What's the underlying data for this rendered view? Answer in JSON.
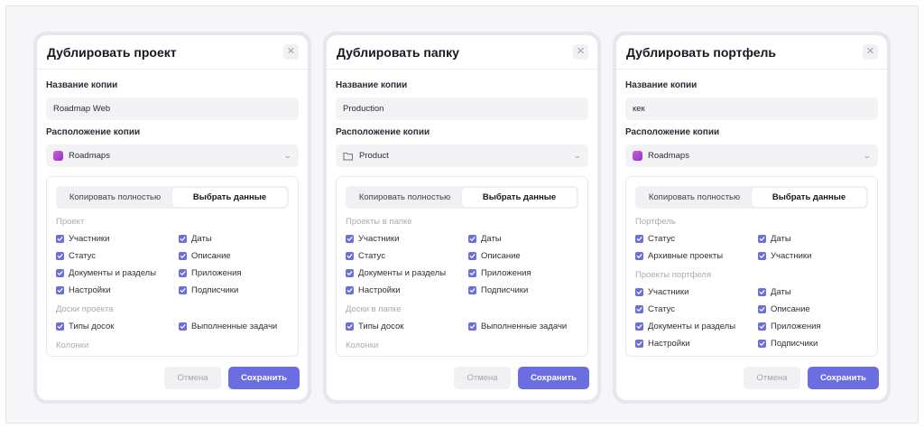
{
  "dialogs": [
    {
      "title": "Дублировать проект",
      "name_label": "Название копии",
      "name_value": "Roadmap Web",
      "location_label": "Расположение копии",
      "location_value": "Roadmaps",
      "location_icon": "project-icon",
      "seg": [
        "Копировать полностью",
        "Выбрать данные"
      ],
      "sections": [
        {
          "title": "Проект",
          "items": [
            "Участники",
            "Даты",
            "Статус",
            "Описание",
            "Документы и разделы",
            "Приложения",
            "Настройки",
            "Подписчики"
          ]
        },
        {
          "title": "Доски проекта",
          "items": [
            "Типы досок",
            "Выполненные задачи"
          ]
        },
        {
          "title": "Колонки",
          "items": []
        }
      ],
      "cancel": "Отмена",
      "save": "Сохранить"
    },
    {
      "title": "Дублировать папку",
      "name_label": "Название копии",
      "name_value": "Production",
      "location_label": "Расположение копии",
      "location_value": "Product",
      "location_icon": "folder-icon",
      "seg": [
        "Копировать полностью",
        "Выбрать данные"
      ],
      "sections": [
        {
          "title": "Проекты в папке",
          "items": [
            "Участники",
            "Даты",
            "Статус",
            "Описание",
            "Документы и разделы",
            "Приложения",
            "Настройки",
            "Подписчики"
          ]
        },
        {
          "title": "Доски в папке",
          "items": [
            "Типы досок",
            "Выполненные задачи"
          ]
        },
        {
          "title": "Колонки",
          "items": []
        }
      ],
      "cancel": "Отмена",
      "save": "Сохранить"
    },
    {
      "title": "Дублировать портфель",
      "name_label": "Название копии",
      "name_value": "кек",
      "location_label": "Расположение копии",
      "location_value": "Roadmaps",
      "location_icon": "project-icon",
      "seg": [
        "Копировать полностью",
        "Выбрать данные"
      ],
      "sections": [
        {
          "title": "Портфель",
          "items": [
            "Статус",
            "Даты",
            "Архивные проекты",
            "Участники"
          ]
        },
        {
          "title": "Проекты портфеля",
          "items": [
            "Участники",
            "Даты",
            "Статус",
            "Описание",
            "Документы и разделы",
            "Приложения",
            "Настройки",
            "Подписчики"
          ]
        }
      ],
      "cancel": "Отмена",
      "save": "Сохранить"
    }
  ],
  "colors": {
    "accent": "#6a6ee0",
    "checkbox": "#6b6fd8",
    "background": "#f6f6f9"
  },
  "icons": {
    "close": "close-icon",
    "chevron": "chevron-down-icon",
    "check": "check-icon"
  }
}
